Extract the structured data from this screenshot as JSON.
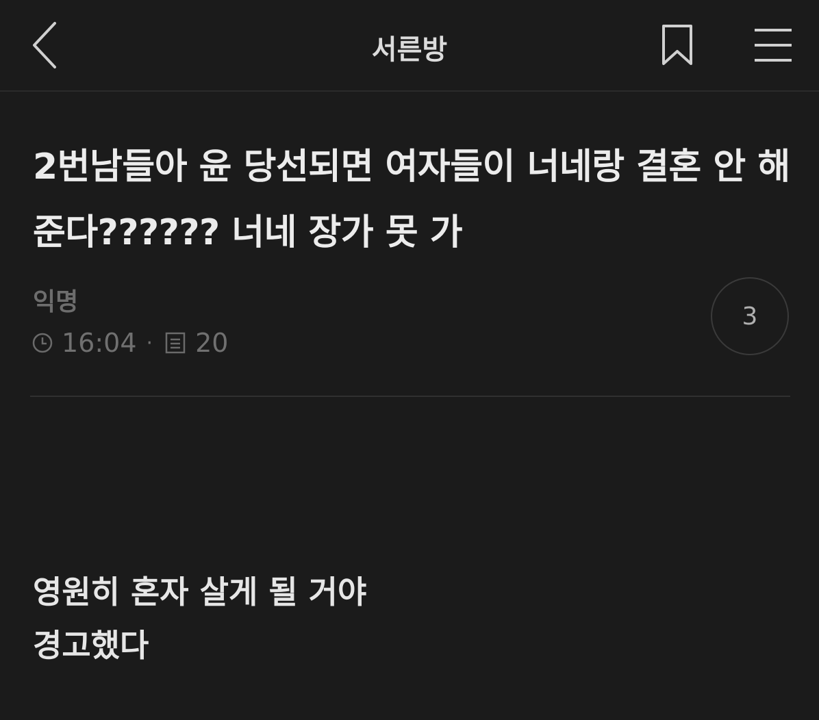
{
  "header": {
    "title": "서른방",
    "back_icon": "chevron-left-icon",
    "bookmark_icon": "bookmark-icon",
    "menu_icon": "hamburger-menu-icon"
  },
  "post": {
    "title": "2번남들아 윤 당선되면 여자들이 너네랑 결혼 안 해준다?????? 너네 장가 못 가",
    "author": "익명",
    "time": "16:04",
    "separator": "·",
    "views": "20",
    "comment_count": "3",
    "body_lines": [
      "영원히 혼자 살게 될 거야",
      "경고했다"
    ]
  },
  "colors": {
    "background": "#1b1b1b",
    "text": "#ececec",
    "muted": "#707070"
  }
}
